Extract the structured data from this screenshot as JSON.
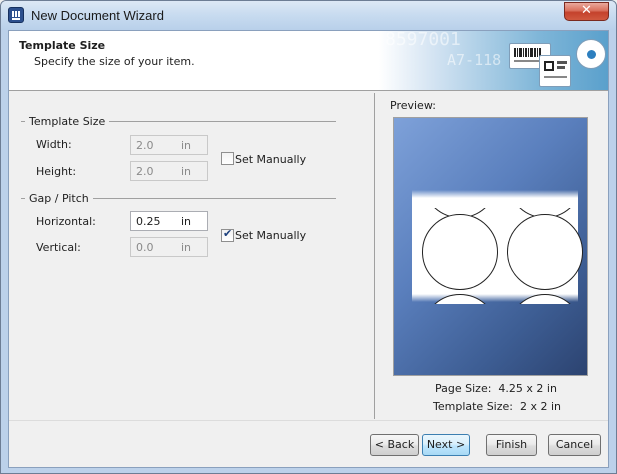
{
  "window": {
    "title": "New Document Wizard",
    "close_glyph": "✕"
  },
  "header": {
    "title": "Template Size",
    "subtitle": "Specify the size of your item.",
    "banner_text_1": "8597001",
    "banner_text_2": "A7-118"
  },
  "template_size": {
    "group_label": "Template Size",
    "width_label": "Width:",
    "width_value": "2.0",
    "width_unit": "in",
    "height_label": "Height:",
    "height_value": "2.0",
    "height_unit": "in",
    "set_manually_label": "Set Manually",
    "set_manually_checked": false
  },
  "gap_pitch": {
    "group_label": "Gap / Pitch",
    "horizontal_label": "Horizontal:",
    "horizontal_value": "0.25",
    "horizontal_unit": "in",
    "vertical_label": "Vertical:",
    "vertical_value": "0.0",
    "vertical_unit": "in",
    "set_manually_label": "Set Manually",
    "set_manually_checked": true,
    "check_glyph": "✔"
  },
  "preview": {
    "label": "Preview:",
    "page_size_label": "Page Size:",
    "page_size_value": "4.25 x 2 in",
    "template_size_label": "Template Size:",
    "template_size_value": "2 x 2 in"
  },
  "buttons": {
    "back": "< Back",
    "next": "Next >",
    "finish": "Finish",
    "cancel": "Cancel"
  },
  "colors": {
    "title_bar": "#c9dcf0",
    "close_button": "#c4422c",
    "preview_background": "#5a7fbd",
    "default_button_border": "#3c7fb1"
  }
}
